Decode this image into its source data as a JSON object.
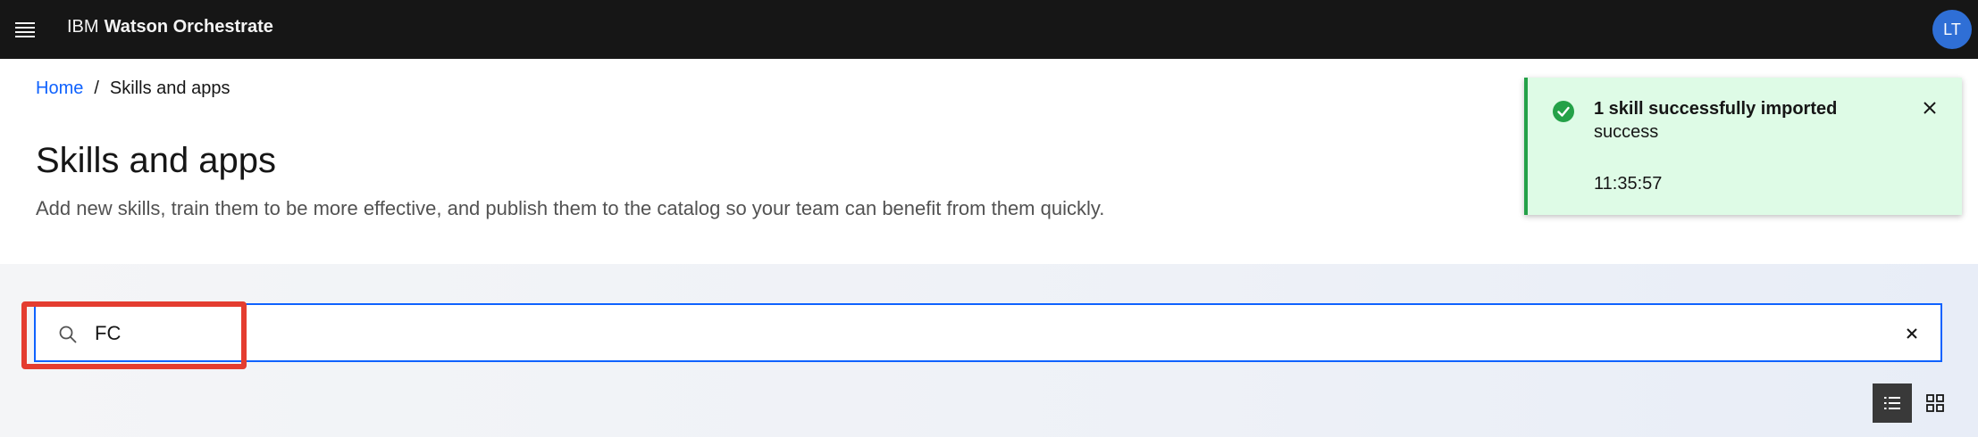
{
  "header": {
    "brand_prefix": "IBM",
    "brand_name": "Watson Orchestrate",
    "avatar_initials": "LT",
    "menu_icon": "hamburger-menu-icon"
  },
  "breadcrumb": {
    "home": "Home",
    "separator": "/",
    "current": "Skills and apps"
  },
  "page": {
    "title": "Skills and apps",
    "description": "Add new skills, train them to be more effective, and publish them to the catalog so your team can benefit from them quickly."
  },
  "search": {
    "value": "FC",
    "icon": "search-icon",
    "clear_icon": "close-icon"
  },
  "toast": {
    "title": "1 skill successfully imported",
    "subtitle": "success",
    "time": "11:35:57",
    "icon": "checkmark-filled-icon",
    "close_icon": "close-icon"
  },
  "view_switcher": {
    "list_icon": "list-view-icon",
    "grid_icon": "grid-view-icon",
    "selected": "list"
  },
  "colors": {
    "topbar": "#161616",
    "link": "#0f62fe",
    "toast_bg": "#defbe6",
    "toast_accent": "#24a148",
    "highlight": "#e43d30",
    "avatar": "#2f6fd6"
  }
}
